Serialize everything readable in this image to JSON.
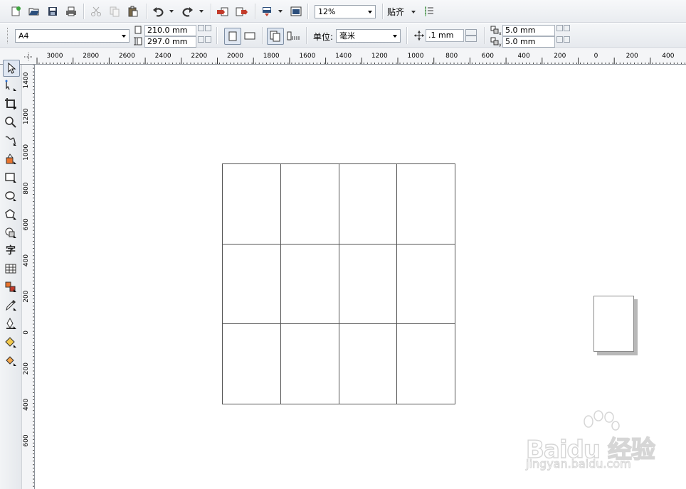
{
  "toolbar": {
    "zoom_value": "12%",
    "snap_label": "贴齐"
  },
  "property_bar": {
    "page_size": "A4",
    "width": "210.0 mm",
    "height": "297.0 mm",
    "unit_label": "单位:",
    "unit_value": "毫米",
    "nudge": ".1 mm",
    "dup_x": "5.0 mm",
    "dup_y": "5.0 mm"
  },
  "ruler_top": {
    "ticks": [
      "3000",
      "2800",
      "2600",
      "2400",
      "2200",
      "2000",
      "1800",
      "1600",
      "1400",
      "1200",
      "1000",
      "800",
      "600",
      "400",
      "200",
      "0",
      "200",
      "400"
    ]
  },
  "ruler_left": {
    "ticks": [
      "1400",
      "1200",
      "1000",
      "800",
      "600",
      "400",
      "200",
      "0",
      "200",
      "400",
      "600"
    ]
  },
  "canvas": {
    "grid": {
      "rows": 3,
      "cols": 4
    }
  },
  "watermark": {
    "brand": "Baidu 经验",
    "url": "jingyan.baidu.com"
  },
  "icons": [
    "new-doc-icon",
    "open-icon",
    "save-icon",
    "print-icon",
    "cut-icon",
    "copy-icon",
    "paste-icon",
    "undo-icon",
    "redo-icon",
    "import-icon",
    "export-icon",
    "app-launcher-icon",
    "full-screen-icon",
    "snap-options-icon",
    "pick-tool-icon",
    "shape-tool-icon",
    "crop-tool-icon",
    "zoom-tool-icon",
    "freehand-tool-icon",
    "smart-fill-icon",
    "rectangle-tool-icon",
    "ellipse-tool-icon",
    "polygon-tool-icon",
    "basic-shapes-icon",
    "text-tool-icon",
    "table-tool-icon",
    "interactive-tool-icon",
    "eyedropper-icon",
    "outline-pen-icon",
    "fill-tool-icon",
    "interactive-fill-icon"
  ],
  "colors": {
    "accent": "#2a6fd1",
    "grid_line": "#555555"
  }
}
